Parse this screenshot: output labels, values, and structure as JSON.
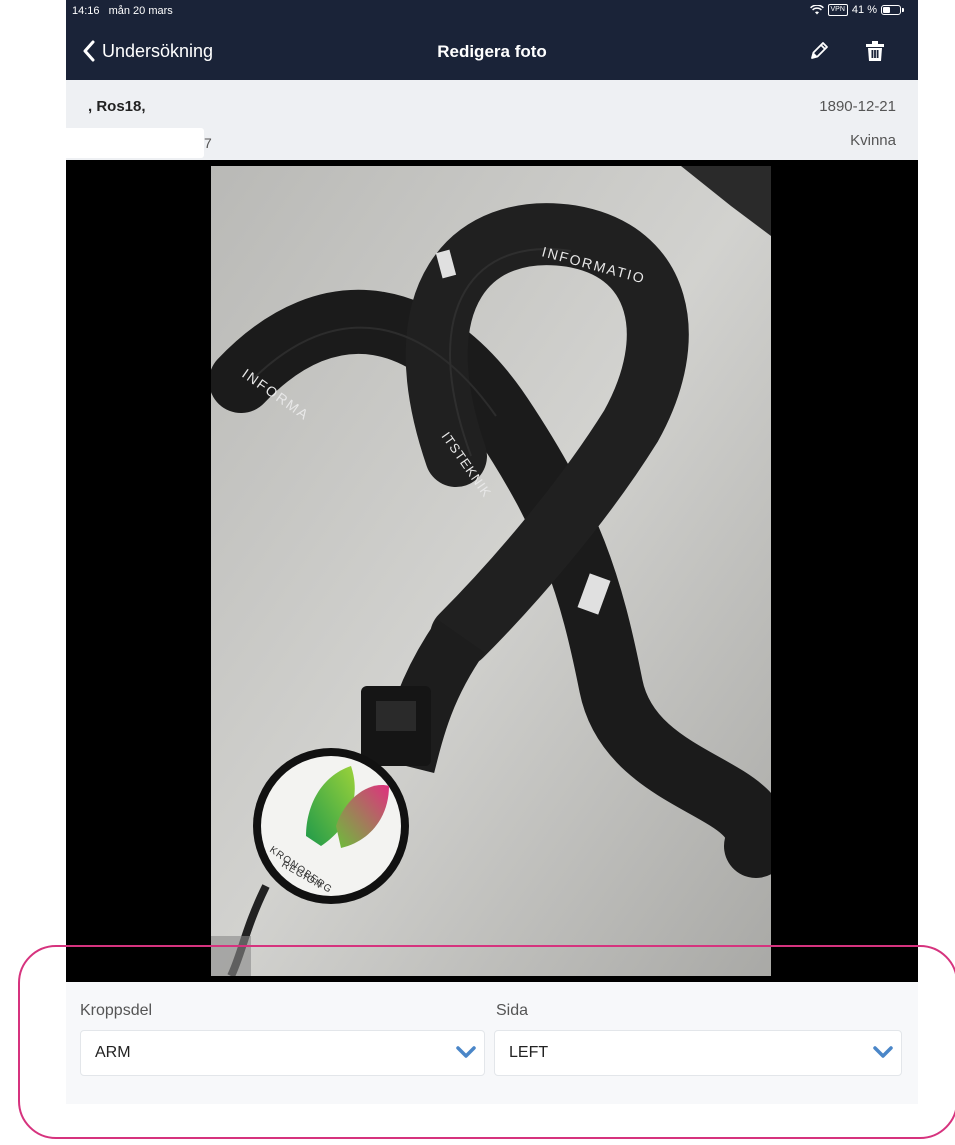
{
  "status_bar": {
    "time": "14:16",
    "date": "mån 20 mars",
    "vpn": "VPN",
    "battery_percent": "41 %",
    "battery_level": 0.41
  },
  "nav": {
    "back_label": "Undersökning",
    "title": "Redigera foto",
    "back_icon": "chevron-left-icon",
    "edit_icon": "pencil-icon",
    "delete_icon": "trash-icon"
  },
  "patient": {
    "name": ", Ros18,",
    "id_suffix": "7",
    "dob": "1890-12-21",
    "sex": "Kvinna"
  },
  "photo": {
    "strap_text_1": "INFORMATIO",
    "strap_text_2": "INFORMA",
    "strap_text_3": "ITSTEKNIK",
    "logo_text_1": "REGION",
    "logo_text_2": "KRONOBERG"
  },
  "form": {
    "body_part_label": "Kroppsdel",
    "body_part_value": "ARM",
    "side_label": "Sida",
    "side_value": "LEFT"
  },
  "colors": {
    "nav_bg": "#1a2338",
    "accent_chevron": "#4a86c8",
    "highlight": "#d6337e"
  }
}
